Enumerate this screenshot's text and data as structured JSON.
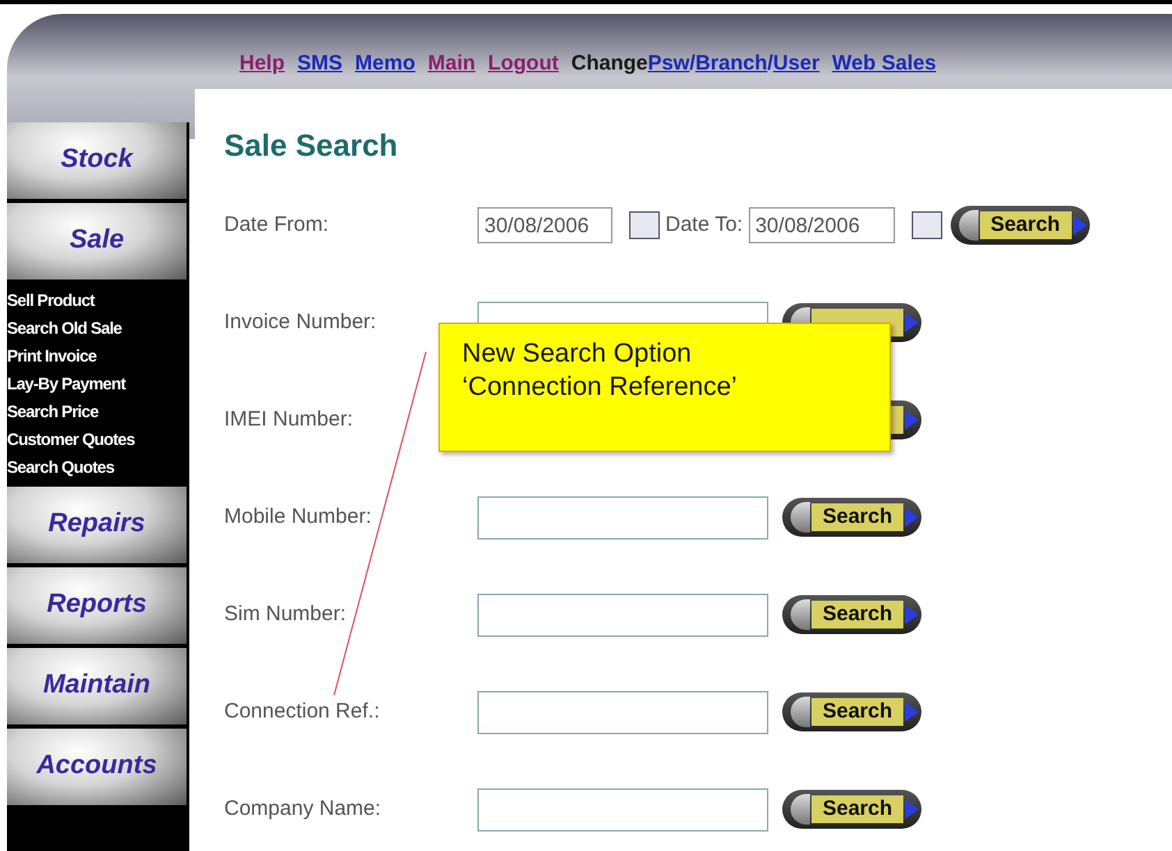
{
  "top_links": [
    {
      "kind": "link",
      "label": "Help",
      "visited": true
    },
    {
      "kind": "link",
      "label": "SMS",
      "visited": false
    },
    {
      "kind": "link",
      "label": "Memo",
      "visited": false
    },
    {
      "kind": "link",
      "label": "Main",
      "visited": true
    },
    {
      "kind": "link",
      "label": "Logout",
      "visited": true
    },
    {
      "kind": "group",
      "label": "Change",
      "separator": "/",
      "parts": [
        {
          "label": "Psw"
        },
        {
          "label": "Branch"
        },
        {
          "label": "User"
        }
      ]
    },
    {
      "kind": "link",
      "label": "Web Sales",
      "visited": false
    }
  ],
  "sidebar": [
    {
      "label": "Stock"
    },
    {
      "label": "Sale",
      "children": [
        {
          "label": "Sell Product"
        },
        {
          "label": "Search Old Sale"
        },
        {
          "label": "Print Invoice"
        },
        {
          "label": "Lay-By Payment"
        },
        {
          "label": "Search Price"
        },
        {
          "label": "Customer Quotes"
        },
        {
          "label": "Search Quotes"
        }
      ]
    },
    {
      "label": "Repairs"
    },
    {
      "label": "Reports"
    },
    {
      "label": "Maintain"
    },
    {
      "label": "Accounts"
    }
  ],
  "page_title": "Sale Search",
  "date_row": {
    "label": "Date From:",
    "from": "30/08/2006",
    "to_label": "Date To:",
    "to": "30/08/2006",
    "button": "Search"
  },
  "rows": [
    {
      "label": "Invoice Number:",
      "field_visible": true
    },
    {
      "label": "IMEI Number:",
      "field_visible": false
    },
    {
      "label": "Mobile Number:",
      "button": "Search"
    },
    {
      "label": "Sim Number:",
      "button": "Search"
    },
    {
      "label": "Connection Ref.:",
      "button": "Search"
    },
    {
      "label": "Company Name:",
      "button": "Search"
    }
  ],
  "callout": {
    "lines": [
      "New Search Option",
      "‘Connection Reference’"
    ]
  }
}
